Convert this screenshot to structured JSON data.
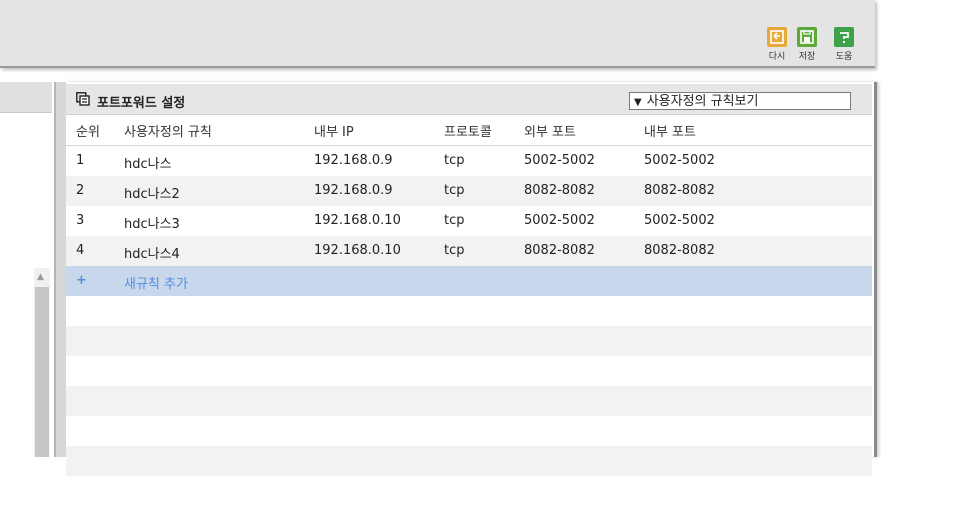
{
  "toolbar": {
    "reload_label": "다시",
    "save_label": "저장",
    "help_label": "도움"
  },
  "panel": {
    "title": "포트포워드 설정",
    "filter_selected": "사용자정의 규칙보기"
  },
  "table": {
    "columns": [
      "순위",
      "사용자정의 규칙",
      "내부 IP",
      "프로토콜",
      "외부 포트",
      "내부 포트"
    ],
    "rows": [
      [
        "1",
        "hdc나스",
        "192.168.0.9",
        "tcp",
        "5002-5002",
        "5002-5002"
      ],
      [
        "2",
        "hdc나스2",
        "192.168.0.9",
        "tcp",
        "8082-8082",
        "8082-8082"
      ],
      [
        "3",
        "hdc나스3",
        "192.168.0.10",
        "tcp",
        "5002-5002",
        "5002-5002"
      ],
      [
        "4",
        "hdc나스4",
        "192.168.0.10",
        "tcp",
        "8082-8082",
        "8082-8082"
      ]
    ],
    "add_symbol": "+",
    "add_label": "새규칙 추가"
  }
}
